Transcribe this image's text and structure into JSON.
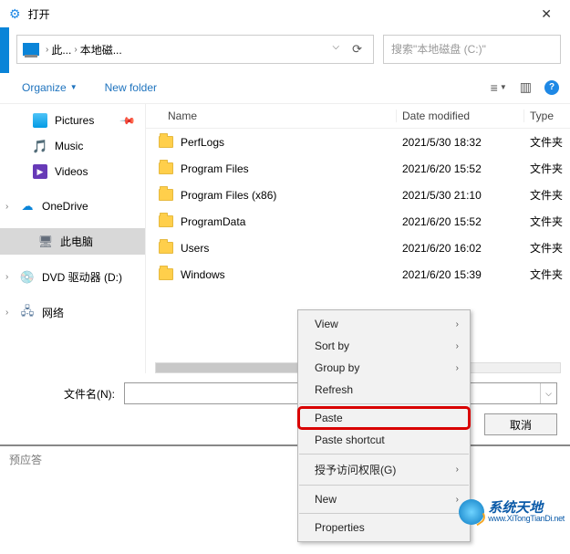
{
  "window": {
    "title": "打开"
  },
  "breadcrumb": {
    "root": "此...",
    "current": "本地磁..."
  },
  "search": {
    "placeholder": "搜索\"本地磁盘 (C:)\""
  },
  "toolbar": {
    "organize": "Organize",
    "newfolder": "New folder"
  },
  "columns": {
    "name": "Name",
    "date": "Date modified",
    "type": "Type"
  },
  "folder_type": "文件夹",
  "files": [
    {
      "name": "PerfLogs",
      "date": "2021/5/30 18:32"
    },
    {
      "name": "Program Files",
      "date": "2021/6/20 15:52"
    },
    {
      "name": "Program Files (x86)",
      "date": "2021/5/30 21:10"
    },
    {
      "name": "ProgramData",
      "date": "2021/6/20 15:52"
    },
    {
      "name": "Users",
      "date": "2021/6/20 16:02"
    },
    {
      "name": "Windows",
      "date": "2021/6/20 15:39"
    }
  ],
  "nav": {
    "pictures": "Pictures",
    "music": "Music",
    "videos": "Videos",
    "onedrive": "OneDrive",
    "thispc": "此电脑",
    "dvd": "DVD 驱动器 (D:)",
    "network": "网络"
  },
  "filename": {
    "label": "文件名(N):"
  },
  "buttons": {
    "cancel": "取消"
  },
  "footer": {
    "text": "预应答"
  },
  "ctx": {
    "view": "View",
    "sortby": "Sort by",
    "groupby": "Group by",
    "refresh": "Refresh",
    "paste": "Paste",
    "pasteshortcut": "Paste shortcut",
    "grantaccess": "授予访问权限(G)",
    "new": "New",
    "properties": "Properties"
  },
  "watermark": {
    "main": "系统天地",
    "sub": "www.XiTongTianDi.net"
  }
}
